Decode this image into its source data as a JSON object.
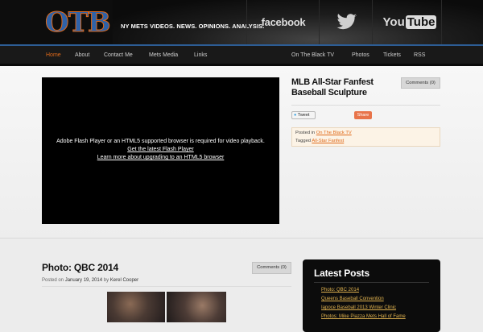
{
  "header": {
    "logo": "OTB",
    "tagline": "NY METS VIDEOS. NEWS. OPINIONS. ANALYSIS.",
    "social": {
      "facebook": "facebook",
      "youtube_you": "You",
      "youtube_tube": "Tube"
    }
  },
  "nav": {
    "left": [
      "Home",
      "About",
      "Contact Me",
      "Mets Media",
      "Links"
    ],
    "right": [
      "On The Black TV",
      "Photos",
      "Tickets",
      "RSS"
    ]
  },
  "featured": {
    "video_msg": "Adobe Flash Player or an HTML5 supported browser is required for video playback.",
    "video_link1": "Get the latest Flash Player",
    "video_link2": "Learn more about upgrading to an HTML5 browser",
    "title": "MLB All-Star Fanfest Baseball Sculpture",
    "comments": "Comments (0)",
    "tweet": "Tweet",
    "share": "Share",
    "posted_label": "Posted in",
    "posted_link": "On The Black TV",
    "tagged_label": "Tagged",
    "tagged_link": "All-Star Fanfest"
  },
  "post": {
    "title": "Photo: QBC 2014",
    "comments": "Comments (0)",
    "posted_on": "Posted on",
    "date": "January 19, 2014",
    "by": "by",
    "author": "Kerel Cooper"
  },
  "sidebar": {
    "title": "Latest Posts",
    "links": [
      "Photo: QBC 2014",
      "Queens Baseball Convention",
      "Iapoce Baseball 2013 Winter Clinic",
      "Photos: Mike Piazza Mets Hall of Fame"
    ]
  }
}
